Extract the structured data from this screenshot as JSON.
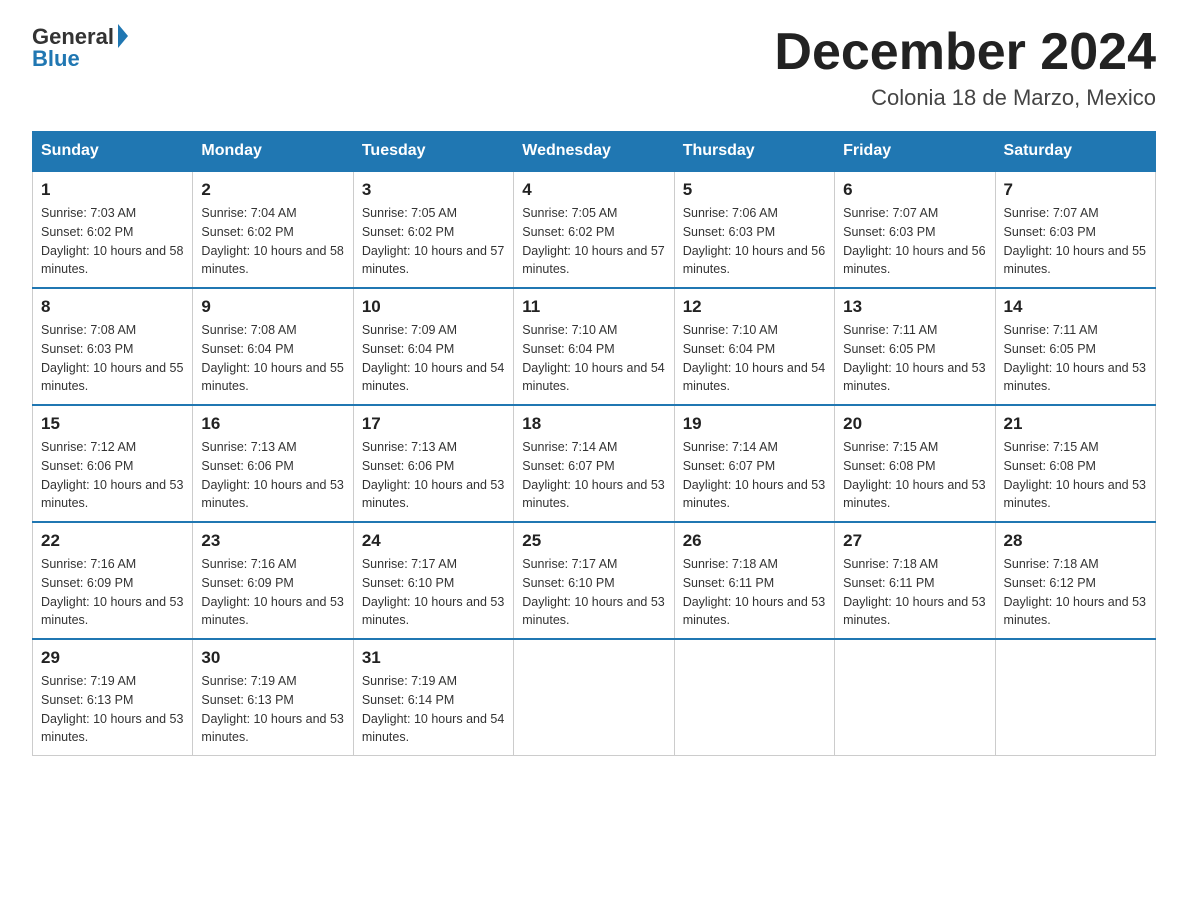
{
  "logo": {
    "general_text": "General",
    "blue_text": "Blue"
  },
  "title": "December 2024",
  "location": "Colonia 18 de Marzo, Mexico",
  "days_of_week": [
    "Sunday",
    "Monday",
    "Tuesday",
    "Wednesday",
    "Thursday",
    "Friday",
    "Saturday"
  ],
  "weeks": [
    [
      {
        "day": "1",
        "sunrise": "7:03 AM",
        "sunset": "6:02 PM",
        "daylight": "10 hours and 58 minutes."
      },
      {
        "day": "2",
        "sunrise": "7:04 AM",
        "sunset": "6:02 PM",
        "daylight": "10 hours and 58 minutes."
      },
      {
        "day": "3",
        "sunrise": "7:05 AM",
        "sunset": "6:02 PM",
        "daylight": "10 hours and 57 minutes."
      },
      {
        "day": "4",
        "sunrise": "7:05 AM",
        "sunset": "6:02 PM",
        "daylight": "10 hours and 57 minutes."
      },
      {
        "day": "5",
        "sunrise": "7:06 AM",
        "sunset": "6:03 PM",
        "daylight": "10 hours and 56 minutes."
      },
      {
        "day": "6",
        "sunrise": "7:07 AM",
        "sunset": "6:03 PM",
        "daylight": "10 hours and 56 minutes."
      },
      {
        "day": "7",
        "sunrise": "7:07 AM",
        "sunset": "6:03 PM",
        "daylight": "10 hours and 55 minutes."
      }
    ],
    [
      {
        "day": "8",
        "sunrise": "7:08 AM",
        "sunset": "6:03 PM",
        "daylight": "10 hours and 55 minutes."
      },
      {
        "day": "9",
        "sunrise": "7:08 AM",
        "sunset": "6:04 PM",
        "daylight": "10 hours and 55 minutes."
      },
      {
        "day": "10",
        "sunrise": "7:09 AM",
        "sunset": "6:04 PM",
        "daylight": "10 hours and 54 minutes."
      },
      {
        "day": "11",
        "sunrise": "7:10 AM",
        "sunset": "6:04 PM",
        "daylight": "10 hours and 54 minutes."
      },
      {
        "day": "12",
        "sunrise": "7:10 AM",
        "sunset": "6:04 PM",
        "daylight": "10 hours and 54 minutes."
      },
      {
        "day": "13",
        "sunrise": "7:11 AM",
        "sunset": "6:05 PM",
        "daylight": "10 hours and 53 minutes."
      },
      {
        "day": "14",
        "sunrise": "7:11 AM",
        "sunset": "6:05 PM",
        "daylight": "10 hours and 53 minutes."
      }
    ],
    [
      {
        "day": "15",
        "sunrise": "7:12 AM",
        "sunset": "6:06 PM",
        "daylight": "10 hours and 53 minutes."
      },
      {
        "day": "16",
        "sunrise": "7:13 AM",
        "sunset": "6:06 PM",
        "daylight": "10 hours and 53 minutes."
      },
      {
        "day": "17",
        "sunrise": "7:13 AM",
        "sunset": "6:06 PM",
        "daylight": "10 hours and 53 minutes."
      },
      {
        "day": "18",
        "sunrise": "7:14 AM",
        "sunset": "6:07 PM",
        "daylight": "10 hours and 53 minutes."
      },
      {
        "day": "19",
        "sunrise": "7:14 AM",
        "sunset": "6:07 PM",
        "daylight": "10 hours and 53 minutes."
      },
      {
        "day": "20",
        "sunrise": "7:15 AM",
        "sunset": "6:08 PM",
        "daylight": "10 hours and 53 minutes."
      },
      {
        "day": "21",
        "sunrise": "7:15 AM",
        "sunset": "6:08 PM",
        "daylight": "10 hours and 53 minutes."
      }
    ],
    [
      {
        "day": "22",
        "sunrise": "7:16 AM",
        "sunset": "6:09 PM",
        "daylight": "10 hours and 53 minutes."
      },
      {
        "day": "23",
        "sunrise": "7:16 AM",
        "sunset": "6:09 PM",
        "daylight": "10 hours and 53 minutes."
      },
      {
        "day": "24",
        "sunrise": "7:17 AM",
        "sunset": "6:10 PM",
        "daylight": "10 hours and 53 minutes."
      },
      {
        "day": "25",
        "sunrise": "7:17 AM",
        "sunset": "6:10 PM",
        "daylight": "10 hours and 53 minutes."
      },
      {
        "day": "26",
        "sunrise": "7:18 AM",
        "sunset": "6:11 PM",
        "daylight": "10 hours and 53 minutes."
      },
      {
        "day": "27",
        "sunrise": "7:18 AM",
        "sunset": "6:11 PM",
        "daylight": "10 hours and 53 minutes."
      },
      {
        "day": "28",
        "sunrise": "7:18 AM",
        "sunset": "6:12 PM",
        "daylight": "10 hours and 53 minutes."
      }
    ],
    [
      {
        "day": "29",
        "sunrise": "7:19 AM",
        "sunset": "6:13 PM",
        "daylight": "10 hours and 53 minutes."
      },
      {
        "day": "30",
        "sunrise": "7:19 AM",
        "sunset": "6:13 PM",
        "daylight": "10 hours and 53 minutes."
      },
      {
        "day": "31",
        "sunrise": "7:19 AM",
        "sunset": "6:14 PM",
        "daylight": "10 hours and 54 minutes."
      },
      null,
      null,
      null,
      null
    ]
  ],
  "labels": {
    "sunrise_prefix": "Sunrise: ",
    "sunset_prefix": "Sunset: ",
    "daylight_prefix": "Daylight: "
  }
}
